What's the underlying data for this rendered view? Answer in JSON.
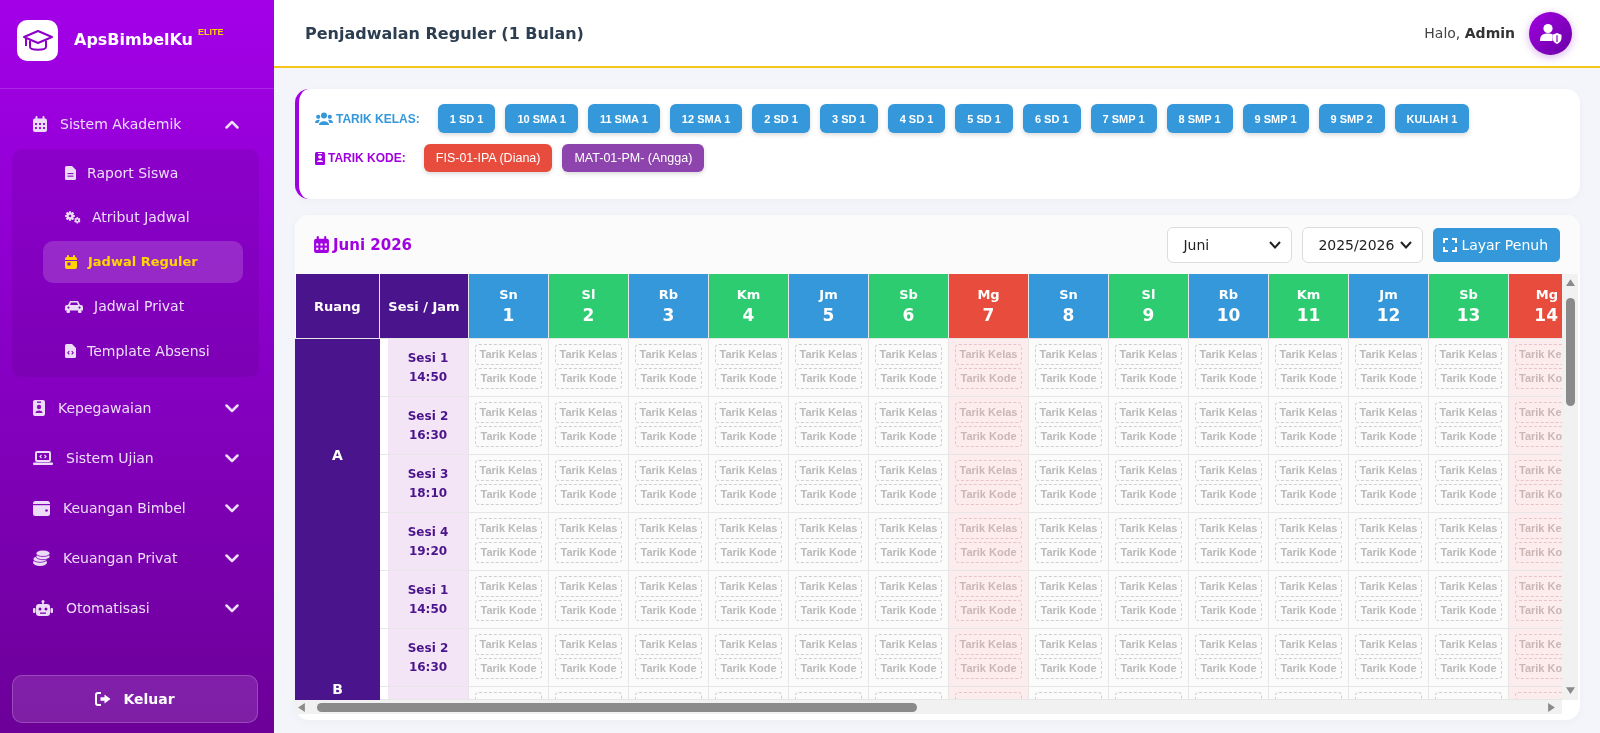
{
  "sidebar": {
    "brand": {
      "name": "ApsBimbelKu",
      "edition": "ELITE"
    },
    "menu": [
      {
        "label": "Sistem Akademik",
        "expanded": true,
        "children": [
          {
            "label": "Raport Siswa",
            "selected": false
          },
          {
            "label": "Atribut Jadwal",
            "selected": false
          },
          {
            "label": "Jadwal Reguler",
            "selected": true
          },
          {
            "label": "Jadwal Privat",
            "selected": false
          },
          {
            "label": "Template Absensi",
            "selected": false
          }
        ]
      },
      {
        "label": "Kepegawaian",
        "expanded": false
      },
      {
        "label": "Sistem Ujian",
        "expanded": false
      },
      {
        "label": "Keuangan Bimbel",
        "expanded": false
      },
      {
        "label": "Keuangan Privat",
        "expanded": false
      },
      {
        "label": "Otomatisasi",
        "expanded": false
      }
    ],
    "logout": "Keluar"
  },
  "header": {
    "title": "Penjadwalan Reguler (1 Bulan)",
    "greeting": "Halo, **Admin**"
  },
  "pull_panel": {
    "kelas": {
      "label": "TARIK KELAS:",
      "chips": [
        "1 SD 1",
        "10 SMA 1",
        "11 SMA 1",
        "12 SMA 1",
        "2 SD 1",
        "3 SD 1",
        "4 SD 1",
        "5 SD 1",
        "6 SD 1",
        "7 SMP 1",
        "8 SMP 1",
        "9 SMP 1",
        "9 SMP 2",
        "KULIAH 1"
      ]
    },
    "kode": {
      "label": "TARIK KODE:",
      "chips": [
        {
          "label": "FIS-01-IPA (Diana)",
          "color": "#e74c3c"
        },
        {
          "label": "MAT-01-PM- (Angga)",
          "color": "#8e44ad"
        }
      ]
    }
  },
  "schedule": {
    "title": "Juni 2026",
    "month": "Juni",
    "year": "2025/2026",
    "fullscreen": "Layar Penuh",
    "room_header": "Ruang",
    "session_header": "Sesi / Jam",
    "days": [
      {
        "name": "Sn",
        "date": "1",
        "color": "#3498db",
        "holiday": false
      },
      {
        "name": "Sl",
        "date": "2",
        "color": "#2ecc71",
        "holiday": false
      },
      {
        "name": "Rb",
        "date": "3",
        "color": "#3498db",
        "holiday": false
      },
      {
        "name": "Km",
        "date": "4",
        "color": "#2ecc71",
        "holiday": false
      },
      {
        "name": "Jm",
        "date": "5",
        "color": "#3498db",
        "holiday": false
      },
      {
        "name": "Sb",
        "date": "6",
        "color": "#2ecc71",
        "holiday": false
      },
      {
        "name": "Mg",
        "date": "7",
        "color": "#e74c3c",
        "holiday": true
      },
      {
        "name": "Sn",
        "date": "8",
        "color": "#3498db",
        "holiday": false
      },
      {
        "name": "Sl",
        "date": "9",
        "color": "#2ecc71",
        "holiday": false
      },
      {
        "name": "Rb",
        "date": "10",
        "color": "#3498db",
        "holiday": false
      },
      {
        "name": "Km",
        "date": "11",
        "color": "#2ecc71",
        "holiday": false
      },
      {
        "name": "Jm",
        "date": "12",
        "color": "#3498db",
        "holiday": false
      },
      {
        "name": "Sb",
        "date": "13",
        "color": "#2ecc71",
        "holiday": false
      },
      {
        "name": "Mg",
        "date": "14",
        "color": "#e74c3c",
        "holiday": true
      }
    ],
    "rooms": [
      {
        "name": "A",
        "cut_below": false,
        "sessions": [
          {
            "name": "Sesi 1",
            "time": "14:50",
            "cells": [
              [
                "Tarik Kelas",
                "Tarik Kode"
              ],
              [
                "Tarik Kelas",
                "Tarik Kode"
              ],
              [
                "Tarik Kelas",
                "Tarik Kode"
              ],
              [
                "Tarik Kelas",
                "Tarik Kode"
              ],
              [
                "Tarik Kelas",
                "Tarik Kode"
              ],
              [
                "Tarik Kelas",
                "Tarik Kode"
              ],
              [
                "Tarik Kelas",
                "Tarik Kode"
              ],
              [
                "Tarik Kelas",
                "Tarik Kode"
              ],
              [
                "Tarik Kelas",
                "Tarik Kode"
              ],
              [
                "Tarik Kelas",
                "Tarik Kode"
              ],
              [
                "Tarik Kelas",
                "Tarik Kode"
              ],
              [
                "Tarik Kelas",
                "Tarik Kode"
              ],
              [
                "Tarik Kelas",
                "Tarik Kode"
              ],
              [
                "Tarik Ke",
                "Tarik Ko"
              ]
            ]
          },
          {
            "name": "Sesi 2",
            "time": "16:30",
            "cells": [
              [
                "Tarik Kelas",
                "Tarik Kode"
              ],
              [
                "Tarik Kelas",
                "Tarik Kode"
              ],
              [
                "Tarik Kelas",
                "Tarik Kode"
              ],
              [
                "Tarik Kelas",
                "Tarik Kode"
              ],
              [
                "Tarik Kelas",
                "Tarik Kode"
              ],
              [
                "Tarik Kelas",
                "Tarik Kode"
              ],
              [
                "Tarik Kelas",
                "Tarik Kode"
              ],
              [
                "Tarik Kelas",
                "Tarik Kode"
              ],
              [
                "Tarik Kelas",
                "Tarik Kode"
              ],
              [
                "Tarik Kelas",
                "Tarik Kode"
              ],
              [
                "Tarik Kelas",
                "Tarik Kode"
              ],
              [
                "Tarik Kelas",
                "Tarik Kode"
              ],
              [
                "Tarik Kelas",
                "Tarik Kode"
              ],
              [
                "Tarik Ke",
                "Tarik Ko"
              ]
            ]
          },
          {
            "name": "Sesi 3",
            "time": "18:10",
            "cells": [
              [
                "Tarik Kelas",
                "Tarik Kode"
              ],
              [
                "Tarik Kelas",
                "Tarik Kode"
              ],
              [
                "Tarik Kelas",
                "Tarik Kode"
              ],
              [
                "Tarik Kelas",
                "Tarik Kode"
              ],
              [
                "Tarik Kelas",
                "Tarik Kode"
              ],
              [
                "Tarik Kelas",
                "Tarik Kode"
              ],
              [
                "Tarik Kelas",
                "Tarik Kode"
              ],
              [
                "Tarik Kelas",
                "Tarik Kode"
              ],
              [
                "Tarik Kelas",
                "Tarik Kode"
              ],
              [
                "Tarik Kelas",
                "Tarik Kode"
              ],
              [
                "Tarik Kelas",
                "Tarik Kode"
              ],
              [
                "Tarik Kelas",
                "Tarik Kode"
              ],
              [
                "Tarik Kelas",
                "Tarik Kode"
              ],
              [
                "Tarik Ke",
                "Tarik Ko"
              ]
            ]
          },
          {
            "name": "Sesi 4",
            "time": "19:20",
            "cells": [
              [
                "Tarik Kelas",
                "Tarik Kode"
              ],
              [
                "Tarik Kelas",
                "Tarik Kode"
              ],
              [
                "Tarik Kelas",
                "Tarik Kode"
              ],
              [
                "Tarik Kelas",
                "Tarik Kode"
              ],
              [
                "Tarik Kelas",
                "Tarik Kode"
              ],
              [
                "Tarik Kelas",
                "Tarik Kode"
              ],
              [
                "Tarik Kelas",
                "Tarik Kode"
              ],
              [
                "Tarik Kelas",
                "Tarik Kode"
              ],
              [
                "Tarik Kelas",
                "Tarik Kode"
              ],
              [
                "Tarik Kelas",
                "Tarik Kode"
              ],
              [
                "Tarik Kelas",
                "Tarik Kode"
              ],
              [
                "Tarik Kelas",
                "Tarik Kode"
              ],
              [
                "Tarik Kelas",
                "Tarik Kode"
              ],
              [
                "Tarik Ke",
                "Tarik Ko"
              ]
            ]
          }
        ]
      },
      {
        "name": "B",
        "cut_below": true,
        "sessions": [
          {
            "name": "Sesi 1",
            "time": "14:50",
            "cells": [
              [
                "Tarik Kelas",
                "Tarik Kode"
              ],
              [
                "Tarik Kelas",
                "Tarik Kode"
              ],
              [
                "Tarik Kelas",
                "Tarik Kode"
              ],
              [
                "Tarik Kelas",
                "Tarik Kode"
              ],
              [
                "Tarik Kelas",
                "Tarik Kode"
              ],
              [
                "Tarik Kelas",
                "Tarik Kode"
              ],
              [
                "Tarik Kelas",
                "Tarik Kode"
              ],
              [
                "Tarik Kelas",
                "Tarik Kode"
              ],
              [
                "Tarik Kelas",
                "Tarik Kode"
              ],
              [
                "Tarik Kelas",
                "Tarik Kode"
              ],
              [
                "Tarik Kelas",
                "Tarik Kode"
              ],
              [
                "Tarik Kelas",
                "Tarik Kode"
              ],
              [
                "Tarik Kelas",
                "Tarik Kode"
              ],
              [
                "Tarik Ke",
                "Tarik Ko"
              ]
            ]
          },
          {
            "name": "Sesi 2",
            "time": "16:30",
            "cells": [
              [
                "Tarik Kelas",
                "Tarik Kode"
              ],
              [
                "Tarik Kelas",
                "Tarik Kode"
              ],
              [
                "Tarik Kelas",
                "Tarik Kode"
              ],
              [
                "Tarik Kelas",
                "Tarik Kode"
              ],
              [
                "Tarik Kelas",
                "Tarik Kode"
              ],
              [
                "Tarik Kelas",
                "Tarik Kode"
              ],
              [
                "Tarik Kelas",
                "Tarik Kode"
              ],
              [
                "Tarik Kelas",
                "Tarik Kode"
              ],
              [
                "Tarik Kelas",
                "Tarik Kode"
              ],
              [
                "Tarik Kelas",
                "Tarik Kode"
              ],
              [
                "Tarik Kelas",
                "Tarik Kode"
              ],
              [
                "Tarik Kelas",
                "Tarik Kode"
              ],
              [
                "Tarik Kelas",
                "Tarik Kode"
              ],
              [
                "Tarik Ke",
                "Tarik Ko"
              ]
            ]
          }
        ]
      }
    ]
  }
}
